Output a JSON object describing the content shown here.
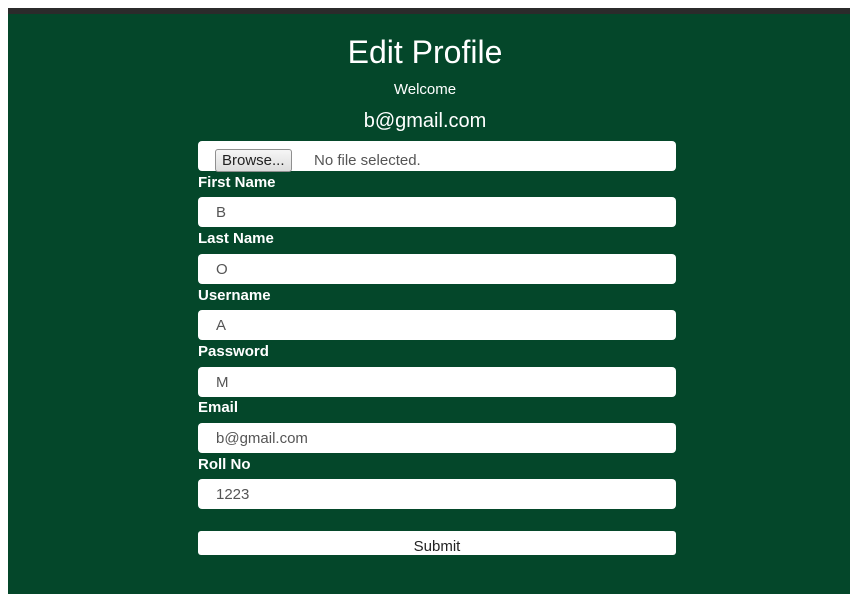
{
  "page": {
    "title": "Edit Profile",
    "welcome": "Welcome",
    "user_email": "b@gmail.com"
  },
  "file_upload": {
    "button_label": "Browse...",
    "status": "No file selected."
  },
  "fields": {
    "first_name": {
      "label": "First Name",
      "value": "B"
    },
    "last_name": {
      "label": "Last Name",
      "value": "O"
    },
    "username": {
      "label": "Username",
      "value": "A"
    },
    "password": {
      "label": "Password",
      "value": "M"
    },
    "email": {
      "label": "Email",
      "value": "b@gmail.com"
    },
    "roll_no": {
      "label": "Roll No",
      "value": "1223"
    }
  },
  "submit": {
    "label": "Submit"
  },
  "colors": {
    "panel_background": "#04472a",
    "top_bar": "#2b2b2b",
    "text": "#ffffff"
  }
}
